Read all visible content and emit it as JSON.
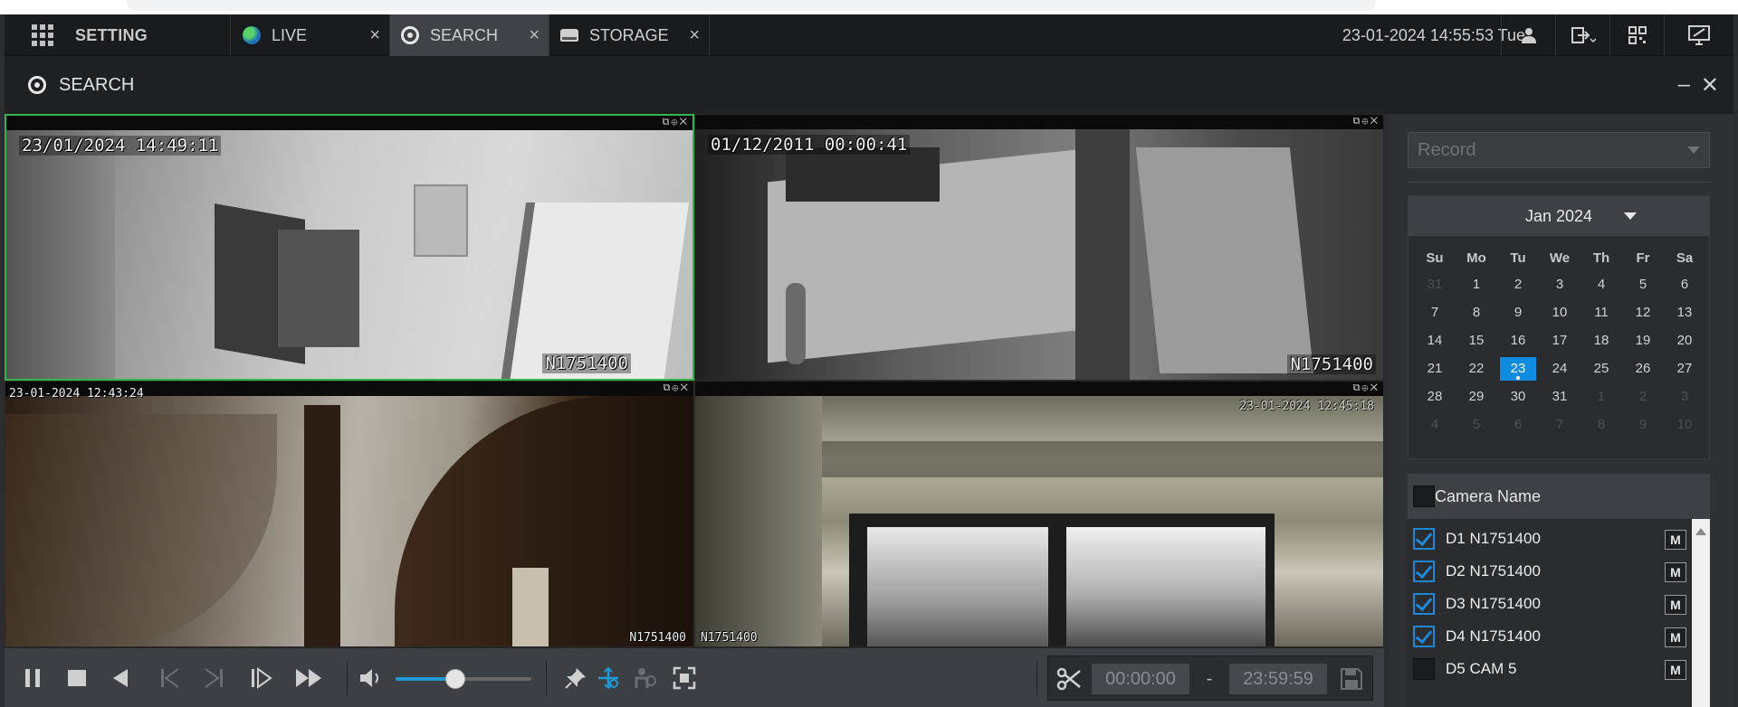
{
  "top_tabs": {
    "setting_label": "SETTING",
    "tabs": [
      {
        "label": "LIVE",
        "icon": "globe-icon"
      },
      {
        "label": "SEARCH",
        "icon": "search-icon"
      },
      {
        "label": "STORAGE",
        "icon": "storage-icon"
      }
    ],
    "close_glyph": "×",
    "datetime": "23-01-2024 14:55:53 Tue"
  },
  "search_header": {
    "title": "SEARCH",
    "minimize_glyph": "–",
    "close_glyph": "✕"
  },
  "video_panes": [
    {
      "timestamp": "23/01/2024 14:49:11",
      "camera_label": "N1751400",
      "selected": true
    },
    {
      "timestamp": "01/12/2011 00:00:41",
      "camera_label": "N1751400",
      "selected": false
    },
    {
      "timestamp": "23-01-2024 12:43:24",
      "camera_label": "N1751400",
      "selected": false
    },
    {
      "timestamp": "23-01-2024 12:45:18",
      "camera_label": "N1751400",
      "selected": false
    }
  ],
  "pane_tools": "⧉⊕✕",
  "controls": {
    "volume_level_percent": 44,
    "clip_start": "00:00:00",
    "clip_separator": "-",
    "clip_end": "23:59:59"
  },
  "right_panel": {
    "record_select": {
      "value": "Record"
    },
    "calendar": {
      "month_label": "Jan 2024",
      "weekdays": [
        "Su",
        "Mo",
        "Tu",
        "We",
        "Th",
        "Fr",
        "Sa"
      ],
      "days": [
        {
          "d": "31",
          "dim": true
        },
        {
          "d": "1"
        },
        {
          "d": "2"
        },
        {
          "d": "3"
        },
        {
          "d": "4"
        },
        {
          "d": "5"
        },
        {
          "d": "6"
        },
        {
          "d": "7"
        },
        {
          "d": "8"
        },
        {
          "d": "9"
        },
        {
          "d": "10"
        },
        {
          "d": "11"
        },
        {
          "d": "12"
        },
        {
          "d": "13"
        },
        {
          "d": "14"
        },
        {
          "d": "15"
        },
        {
          "d": "16"
        },
        {
          "d": "17"
        },
        {
          "d": "18"
        },
        {
          "d": "19"
        },
        {
          "d": "20"
        },
        {
          "d": "21"
        },
        {
          "d": "22"
        },
        {
          "d": "23",
          "today": true,
          "has_record": true
        },
        {
          "d": "24"
        },
        {
          "d": "25"
        },
        {
          "d": "26"
        },
        {
          "d": "27"
        },
        {
          "d": "28"
        },
        {
          "d": "29"
        },
        {
          "d": "30"
        },
        {
          "d": "31"
        },
        {
          "d": "1",
          "dim": true
        },
        {
          "d": "2",
          "dim": true
        },
        {
          "d": "3",
          "dim": true
        },
        {
          "d": "4",
          "dim": true
        },
        {
          "d": "5",
          "dim": true
        },
        {
          "d": "6",
          "dim": true
        },
        {
          "d": "7",
          "dim": true
        },
        {
          "d": "8",
          "dim": true
        },
        {
          "d": "9",
          "dim": true
        },
        {
          "d": "10",
          "dim": true
        }
      ]
    },
    "camera_header": "Camera Name",
    "cameras": [
      {
        "name": "D1 N1751400",
        "checked": true
      },
      {
        "name": "D2 N1751400",
        "checked": true
      },
      {
        "name": "D3 N1751400",
        "checked": true
      },
      {
        "name": "D4 N1751400",
        "checked": true
      },
      {
        "name": "D5 CAM 5",
        "checked": false
      }
    ],
    "m_label": "M"
  },
  "colors": {
    "accent_blue": "#0f8be0",
    "selected_pane_border": "#35b44a"
  }
}
